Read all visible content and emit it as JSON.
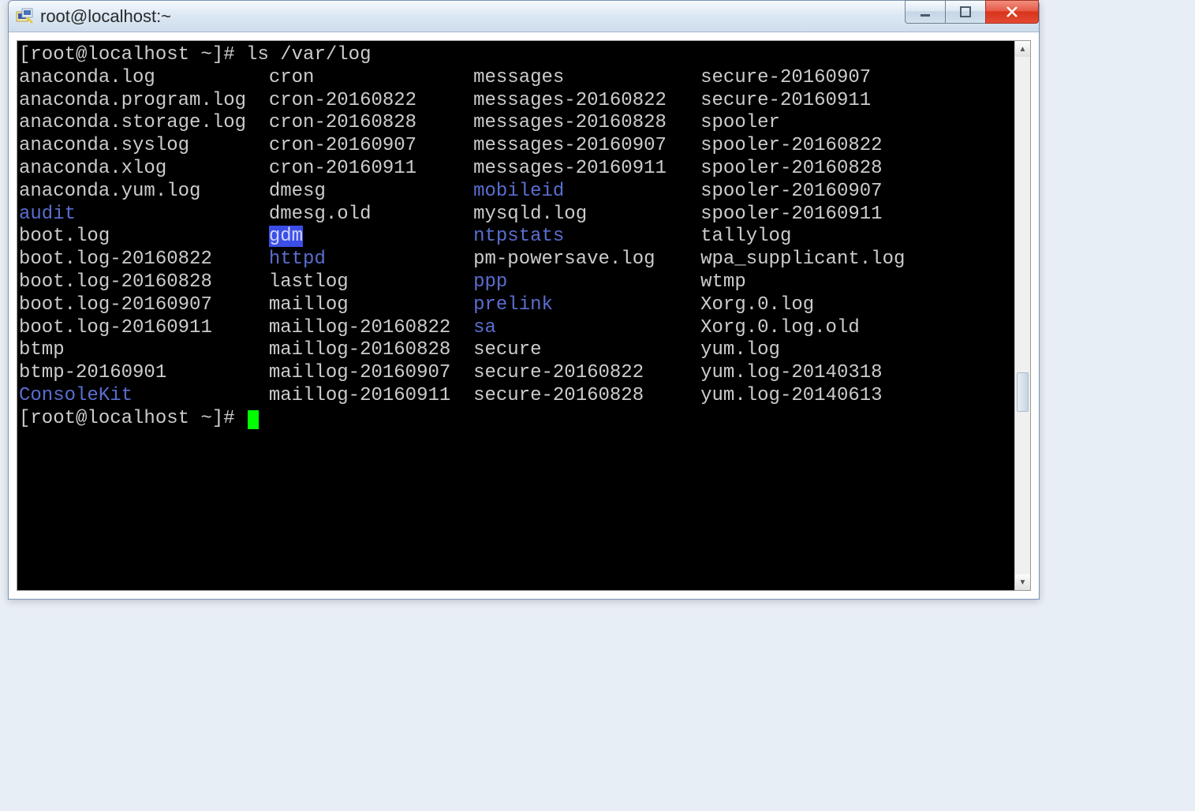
{
  "window": {
    "title": "root@localhost:~"
  },
  "terminal": {
    "prompt": "[root@localhost ~]# ",
    "command": "ls /var/log",
    "columns": [
      [
        {
          "name": "anaconda.log",
          "type": "file"
        },
        {
          "name": "anaconda.program.log",
          "type": "file"
        },
        {
          "name": "anaconda.storage.log",
          "type": "file"
        },
        {
          "name": "anaconda.syslog",
          "type": "file"
        },
        {
          "name": "anaconda.xlog",
          "type": "file"
        },
        {
          "name": "anaconda.yum.log",
          "type": "file"
        },
        {
          "name": "audit",
          "type": "dir"
        },
        {
          "name": "boot.log",
          "type": "file"
        },
        {
          "name": "boot.log-20160822",
          "type": "file"
        },
        {
          "name": "boot.log-20160828",
          "type": "file"
        },
        {
          "name": "boot.log-20160907",
          "type": "file"
        },
        {
          "name": "boot.log-20160911",
          "type": "file"
        },
        {
          "name": "btmp",
          "type": "file"
        },
        {
          "name": "btmp-20160901",
          "type": "file"
        },
        {
          "name": "ConsoleKit",
          "type": "dir"
        }
      ],
      [
        {
          "name": "cron",
          "type": "file"
        },
        {
          "name": "cron-20160822",
          "type": "file"
        },
        {
          "name": "cron-20160828",
          "type": "file"
        },
        {
          "name": "cron-20160907",
          "type": "file"
        },
        {
          "name": "cron-20160911",
          "type": "file"
        },
        {
          "name": "dmesg",
          "type": "file"
        },
        {
          "name": "dmesg.old",
          "type": "file"
        },
        {
          "name": "gdm",
          "type": "dir",
          "selected": true
        },
        {
          "name": "httpd",
          "type": "dir"
        },
        {
          "name": "lastlog",
          "type": "file"
        },
        {
          "name": "maillog",
          "type": "file"
        },
        {
          "name": "maillog-20160822",
          "type": "file"
        },
        {
          "name": "maillog-20160828",
          "type": "file"
        },
        {
          "name": "maillog-20160907",
          "type": "file"
        },
        {
          "name": "maillog-20160911",
          "type": "file"
        }
      ],
      [
        {
          "name": "messages",
          "type": "file"
        },
        {
          "name": "messages-20160822",
          "type": "file"
        },
        {
          "name": "messages-20160828",
          "type": "file"
        },
        {
          "name": "messages-20160907",
          "type": "file"
        },
        {
          "name": "messages-20160911",
          "type": "file"
        },
        {
          "name": "mobileid",
          "type": "dir"
        },
        {
          "name": "mysqld.log",
          "type": "file"
        },
        {
          "name": "ntpstats",
          "type": "dir"
        },
        {
          "name": "pm-powersave.log",
          "type": "file"
        },
        {
          "name": "ppp",
          "type": "dir"
        },
        {
          "name": "prelink",
          "type": "dir"
        },
        {
          "name": "sa",
          "type": "dir"
        },
        {
          "name": "secure",
          "type": "file"
        },
        {
          "name": "secure-20160822",
          "type": "file"
        },
        {
          "name": "secure-20160828",
          "type": "file"
        }
      ],
      [
        {
          "name": "secure-20160907",
          "type": "file"
        },
        {
          "name": "secure-20160911",
          "type": "file"
        },
        {
          "name": "spooler",
          "type": "file"
        },
        {
          "name": "spooler-20160822",
          "type": "file"
        },
        {
          "name": "spooler-20160828",
          "type": "file"
        },
        {
          "name": "spooler-20160907",
          "type": "file"
        },
        {
          "name": "spooler-20160911",
          "type": "file"
        },
        {
          "name": "tallylog",
          "type": "file"
        },
        {
          "name": "wpa_supplicant.log",
          "type": "file"
        },
        {
          "name": "wtmp",
          "type": "file"
        },
        {
          "name": "Xorg.0.log",
          "type": "file"
        },
        {
          "name": "Xorg.0.log.old",
          "type": "file"
        },
        {
          "name": "yum.log",
          "type": "file"
        },
        {
          "name": "yum.log-20140318",
          "type": "file"
        },
        {
          "name": "yum.log-20140613",
          "type": "file"
        }
      ]
    ]
  }
}
